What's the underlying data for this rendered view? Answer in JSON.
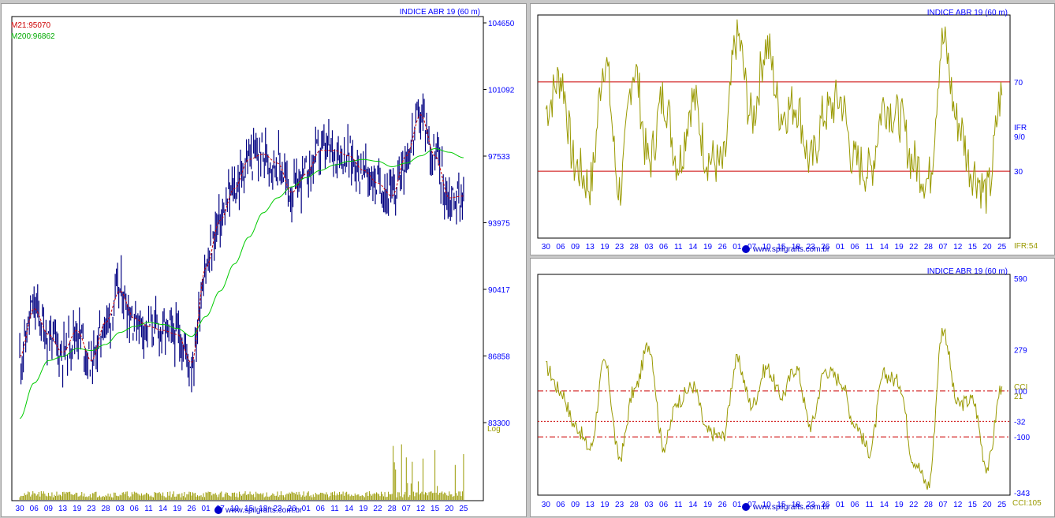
{
  "charts": {
    "price": {
      "title": "INDICE ABR 19 (60 m)",
      "m21_label": "M21:95070",
      "m200_label": "M200:96862",
      "scale_label": "Log",
      "y_ticks": [
        "104650",
        "101092",
        "97533",
        "93975",
        "90417",
        "86858",
        "83300"
      ],
      "watermark": "www.spilgrafts.com.br",
      "colors": {
        "price": "#000080",
        "m21": "#cc0000",
        "m200": "#00cc00",
        "volume": "#999900",
        "text": "#0000ff"
      }
    },
    "ifr": {
      "title": "INDICE ABR 19 (60 m)",
      "y_ticks": [
        "70",
        "30"
      ],
      "indicator_label_1": "IFR",
      "indicator_label_2": "9/0",
      "value_label": "IFR:54",
      "watermark": "www.spilgrafts.com.br"
    },
    "cci": {
      "title": "INDICE ABR 19 (60 m)",
      "y_ticks": [
        "590",
        "279",
        "100",
        "-32",
        "-100",
        "-343"
      ],
      "indicator_label_1": "CCI",
      "indicator_label_2": "21",
      "value_label": "CCI:105",
      "watermark": "www.spilgrafts.com.br"
    },
    "x_ticks": [
      "30",
      "06",
      "09",
      "13",
      "19",
      "23",
      "28",
      "03",
      "06",
      "11",
      "14",
      "19",
      "26",
      "01",
      "07",
      "10",
      "15",
      "18",
      "23",
      "26",
      "01",
      "06",
      "11",
      "14",
      "19",
      "22",
      "28",
      "07",
      "12",
      "15",
      "20",
      "25"
    ]
  },
  "chart_data": [
    {
      "type": "line",
      "title": "INDICE ABR 19 (60 m)",
      "ylim": [
        83300,
        104650
      ],
      "log_scale": true,
      "categories": [
        "30",
        "06",
        "09",
        "13",
        "19",
        "23",
        "28",
        "03",
        "06",
        "11",
        "14",
        "19",
        "26",
        "01",
        "07",
        "10",
        "15",
        "18",
        "23",
        "26",
        "01",
        "06",
        "11",
        "14",
        "19",
        "22",
        "28",
        "07",
        "12",
        "15",
        "20",
        "25"
      ],
      "series": [
        {
          "name": "M21:95070",
          "values": [
            86500,
            88900,
            87600,
            86700,
            87800,
            86300,
            88200,
            89800,
            88400,
            88000,
            87800,
            87600,
            86200,
            91000,
            93500,
            95200,
            96800,
            97100,
            96600,
            95000,
            96000,
            97300,
            97300,
            97000,
            96200,
            95500,
            94800,
            97000,
            99300,
            97000,
            94700,
            94800
          ]
        },
        {
          "name": "M200:96862",
          "values": [
            83500,
            85200,
            86300,
            86500,
            86900,
            86800,
            87100,
            87700,
            88000,
            88200,
            88100,
            87900,
            87500,
            88500,
            89800,
            91200,
            92600,
            93900,
            94700,
            95300,
            95800,
            96200,
            96500,
            96700,
            96800,
            96700,
            96400,
            96600,
            97000,
            97400,
            97200,
            96900
          ]
        }
      ]
    },
    {
      "type": "line",
      "title": "INDICE ABR 19 (60 m)",
      "categories": [
        "30",
        "06",
        "09",
        "13",
        "19",
        "23",
        "28",
        "03",
        "06",
        "11",
        "14",
        "19",
        "26",
        "01",
        "07",
        "10",
        "15",
        "18",
        "23",
        "26",
        "01",
        "06",
        "11",
        "14",
        "19",
        "22",
        "28",
        "07",
        "12",
        "15",
        "20",
        "25"
      ],
      "series": [
        {
          "name": "IFR 9/0",
          "values": [
            58,
            72,
            32,
            24,
            80,
            22,
            76,
            34,
            63,
            34,
            62,
            36,
            32,
            90,
            54,
            86,
            56,
            60,
            34,
            56,
            62,
            34,
            30,
            60,
            54,
            34,
            26,
            88,
            52,
            30,
            20,
            64
          ]
        }
      ],
      "reference_lines": [
        70,
        30
      ]
    },
    {
      "type": "line",
      "title": "INDICE ABR 19 (60 m)",
      "categories": [
        "30",
        "06",
        "09",
        "13",
        "19",
        "23",
        "28",
        "03",
        "06",
        "11",
        "14",
        "19",
        "26",
        "01",
        "07",
        "10",
        "15",
        "18",
        "23",
        "26",
        "01",
        "06",
        "11",
        "14",
        "19",
        "22",
        "28",
        "07",
        "12",
        "15",
        "20",
        "25"
      ],
      "series": [
        {
          "name": "CCI 21",
          "values": [
            200,
            100,
            -50,
            -150,
            220,
            -190,
            100,
            300,
            -140,
            60,
            120,
            -80,
            -100,
            230,
            40,
            200,
            80,
            200,
            -50,
            190,
            150,
            -40,
            -160,
            170,
            140,
            -200,
            -310,
            370,
            40,
            60,
            -230,
            120
          ]
        }
      ],
      "reference_lines": [
        100,
        -32,
        -100
      ]
    }
  ]
}
